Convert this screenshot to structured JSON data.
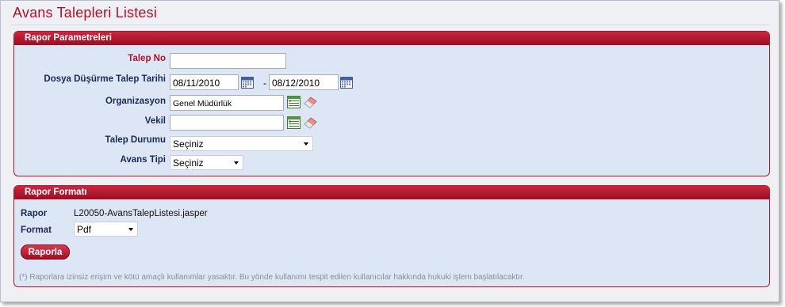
{
  "page": {
    "title": "Avans Talepleri Listesi"
  },
  "parameters": {
    "header": "Rapor Parametreleri",
    "talep_no": {
      "label": "Talep No",
      "value": ""
    },
    "tarih": {
      "label": "Dosya Düşürme Talep Tarihi",
      "start": "08/11/2010",
      "separator": "-",
      "end": "08/12/2010"
    },
    "organizasyon": {
      "label": "Organizasyon",
      "value": "Genel Müdürlük"
    },
    "vekil": {
      "label": "Vekil",
      "value": ""
    },
    "talep_durumu": {
      "label": "Talep Durumu",
      "selected": "Seçiniz"
    },
    "avans_tipi": {
      "label": "Avans Tipi",
      "selected": "Seçiniz"
    }
  },
  "format": {
    "header": "Rapor Formatı",
    "rapor_label": "Rapor",
    "rapor_value": "L20050-AvansTalepListesi.jasper",
    "format_label": "Format",
    "format_selected": "Pdf",
    "button": "Raporla",
    "disclaimer": "(*) Raporlara izinsiz erişim ve kötü amaçlı kullanımlar yasaktır. Bu yönde kullanımı tespit edilen kullanıcılar hakkında hukuki işlem başlatılacaktır."
  },
  "colors": {
    "accent": "#b0102a",
    "panel_bg": "#dde6f4",
    "label": "#1a2a52"
  },
  "icons": [
    "calendar-icon",
    "table-lookup-icon",
    "eraser-icon",
    "dropdown-arrow-icon"
  ]
}
